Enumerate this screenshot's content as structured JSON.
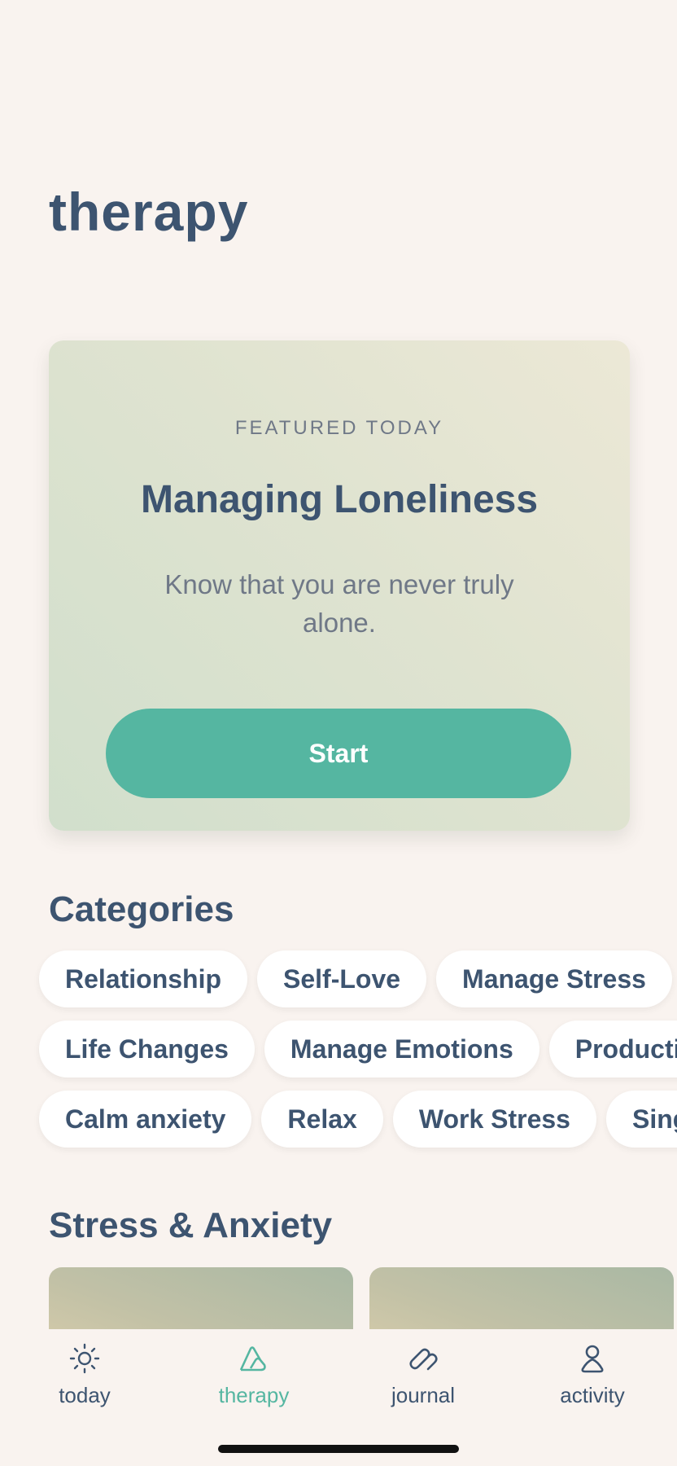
{
  "header": {
    "title": "therapy"
  },
  "featured": {
    "eyebrow": "FEATURED TODAY",
    "title": "Managing Loneliness",
    "subtitle": "Know that you are never truly alone.",
    "start_label": "Start"
  },
  "categories": {
    "heading": "Categories",
    "row1": [
      "Relationship",
      "Self-Love",
      "Manage Stress"
    ],
    "row2": [
      "Life Changes",
      "Manage Emotions",
      "Productivity"
    ],
    "row3": [
      "Calm anxiety",
      "Relax",
      "Work Stress",
      "Sing"
    ]
  },
  "stress": {
    "heading": "Stress & Anxiety"
  },
  "tabs": [
    {
      "label": "today",
      "icon": "sun-icon"
    },
    {
      "label": "therapy",
      "icon": "mountain-icon",
      "active": true
    },
    {
      "label": "journal",
      "icon": "journal-icon"
    },
    {
      "label": "activity",
      "icon": "person-icon"
    }
  ],
  "colors": {
    "background": "#f9f3ef",
    "text": "#3d5470",
    "accent": "#55b6a1",
    "muted": "#6f7887"
  }
}
